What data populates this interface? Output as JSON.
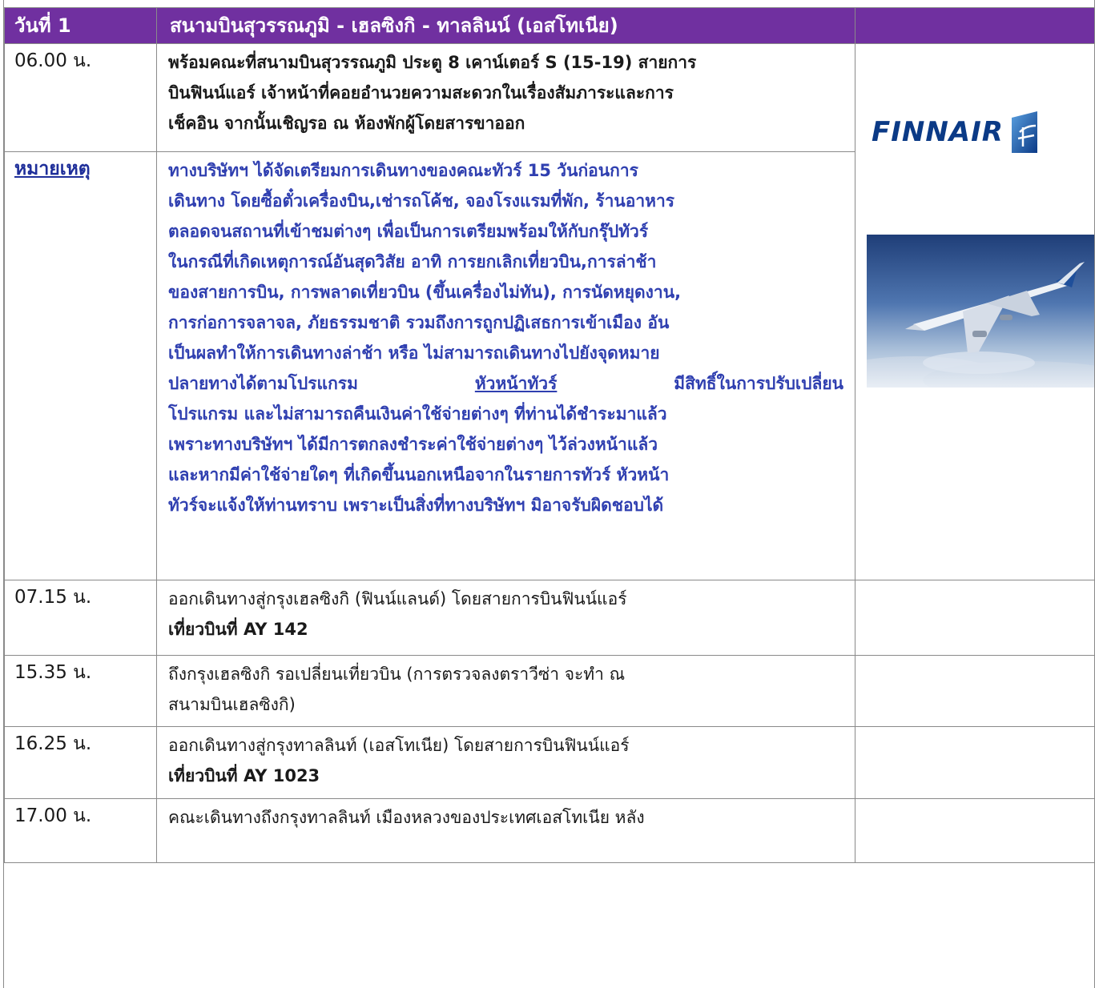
{
  "header": {
    "day": "วันที่ 1",
    "route": "สนามบินสุวรรณภูมิ - เฮลซิงกิ - ทาลลินน์ (เอสโทเนีย)"
  },
  "brand": {
    "logo_text": "FINNAIR"
  },
  "rows": [
    {
      "time": "06.00 น.",
      "lines": [
        "พร้อมคณะที่สนามบินสุวรรณภูมิ ประตู 8 เคาน์เตอร์ S (15-19) สายการ",
        "บินฟินน์แอร์   เจ้าหน้าที่คอยอำนวยความสะดวกในเรื่องสัมภาระและการ",
        "เช็คอิน จากนั้นเชิญรอ ณ ห้องพักผู้โดยสารขาออก"
      ]
    },
    {
      "time": "หมายเหตุ",
      "lines": [
        "ทางบริษัทฯ   ได้จัดเตรียมการเดินทางของคณะทัวร์   15   วันก่อนการ",
        "เดินทาง  โดยซื้อตั๋วเครื่องบิน,เช่ารถโค้ช,  จองโรงแรมที่พัก,  ร้านอาหาร",
        "ตลอดจนสถานที่เข้าชมต่างๆ เพื่อเป็นการเตรียมพร้อมให้กับกรุ๊ปทัวร์",
        "ในกรณีที่เกิดเหตุการณ์อันสุดวิสัย   อาทิ   การยกเลิกเที่ยวบิน,การล่าช้า",
        "ของสายการบิน, การพลาดเที่ยวบิน (ขึ้นเครื่องไม่ทัน), การนัดหยุดงาน,",
        "การก่อการจลาจล,  ภัยธรรมชาติ  รวมถึงการถูกปฏิเสธการเข้าเมือง  อัน",
        "เป็นผลทำให้การเดินทางล่าช้า   หรือ   ไม่สามารถเดินทางไปยังจุดหมาย"
      ],
      "line_before_link": "ปลายทางได้ตามโปรแกรม",
      "link_text": "หัวหน้าทัวร์",
      "line_after_link": "มีสิทธิ์ในการปรับเปลี่ยน",
      "lines_after": [
        "โปรแกรม   และไม่สามารถคืนเงินค่าใช้จ่ายต่างๆ   ที่ท่านได้ชำระมาแล้ว",
        "เพราะทางบริษัทฯ  ได้มีการตกลงชำระค่าใช้จ่ายต่างๆ  ไว้ล่วงหน้าแล้ว",
        "และหากมีค่าใช้จ่ายใดๆ  ที่เกิดขึ้นนอกเหนือจากในรายการทัวร์  หัวหน้า",
        "ทัวร์จะแจ้งให้ท่านทราบ เพราะเป็นสิ่งที่ทางบริษัทฯ มิอาจรับผิดชอบได้"
      ]
    },
    {
      "time": "07.15 น.",
      "line1": "ออกเดินทางสู่กรุงเฮลซิงกิ (ฟินน์แลนด์) โดยสายการบินฟินน์แอร์",
      "line2": "เที่ยวบินที่ AY 142"
    },
    {
      "time": "15.35 น.",
      "line1": "ถึงกรุงเฮลซิงกิ รอเปลี่ยนเที่ยวบิน (การตรวจลงตราวีซ่า จะทำ ณ",
      "line2": "สนามบินเฮลซิงกิ)"
    },
    {
      "time": "16.25 น.",
      "line1": "ออกเดินทางสู่กรุงทาลลินท์ (เอสโทเนีย) โดยสายการบินฟินน์แอร์",
      "line2": "เที่ยวบินที่ AY 1023"
    },
    {
      "time": "17.00 น.",
      "line1": "คณะเดินทางถึงกรุงทาลลินท์ เมืองหลวงของประเทศเอสโทเนีย หลัง"
    }
  ]
}
